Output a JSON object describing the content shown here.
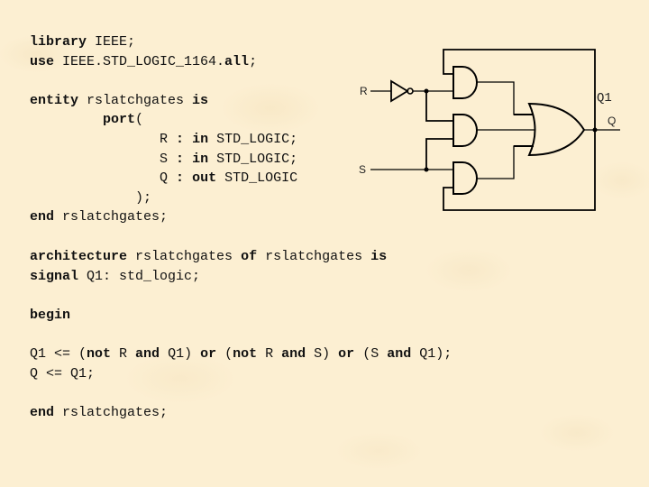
{
  "code_top": [
    [
      {
        "t": "library",
        "b": true
      },
      {
        "t": " IEEE;",
        "b": false
      }
    ],
    [
      {
        "t": "use",
        "b": true
      },
      {
        "t": " IEEE.STD_LOGIC_1164.",
        "b": false
      },
      {
        "t": "all",
        "b": true
      },
      {
        "t": ";",
        "b": false
      }
    ],
    [],
    [
      {
        "t": "entity",
        "b": true
      },
      {
        "t": " rslatchgates ",
        "b": false
      },
      {
        "t": "is",
        "b": true
      }
    ],
    [
      {
        "t": "         ",
        "b": false
      },
      {
        "t": "port",
        "b": true
      },
      {
        "t": "(",
        "b": false
      }
    ],
    [
      {
        "t": "                R ",
        "b": false
      },
      {
        "t": ":",
        "b": true
      },
      {
        "t": " ",
        "b": false
      },
      {
        "t": "in",
        "b": true
      },
      {
        "t": " STD_LOGIC;",
        "b": false
      }
    ],
    [
      {
        "t": "                S ",
        "b": false
      },
      {
        "t": ":",
        "b": true
      },
      {
        "t": " ",
        "b": false
      },
      {
        "t": "in",
        "b": true
      },
      {
        "t": " STD_LOGIC;",
        "b": false
      }
    ],
    [
      {
        "t": "                Q ",
        "b": false
      },
      {
        "t": ":",
        "b": true
      },
      {
        "t": " ",
        "b": false
      },
      {
        "t": "out",
        "b": true
      },
      {
        "t": " STD_LOGIC",
        "b": false
      }
    ],
    [
      {
        "t": "             );",
        "b": false
      }
    ],
    [
      {
        "t": "end",
        "b": true
      },
      {
        "t": " rslatchgates;",
        "b": false
      }
    ]
  ],
  "code_bottom": [
    [
      {
        "t": "architecture",
        "b": true
      },
      {
        "t": " rslatchgates ",
        "b": false
      },
      {
        "t": "of",
        "b": true
      },
      {
        "t": " rslatchgates ",
        "b": false
      },
      {
        "t": "is",
        "b": true
      }
    ],
    [
      {
        "t": "signal",
        "b": true
      },
      {
        "t": " Q1: std_logic;",
        "b": false
      }
    ],
    [],
    [
      {
        "t": "begin",
        "b": true
      }
    ],
    [],
    [
      {
        "t": "Q1 <= (",
        "b": false
      },
      {
        "t": "not",
        "b": true
      },
      {
        "t": " R ",
        "b": false
      },
      {
        "t": "and",
        "b": true
      },
      {
        "t": " Q1) ",
        "b": false
      },
      {
        "t": "or",
        "b": true
      },
      {
        "t": " (",
        "b": false
      },
      {
        "t": "not",
        "b": true
      },
      {
        "t": " R ",
        "b": false
      },
      {
        "t": "and",
        "b": true
      },
      {
        "t": " S) ",
        "b": false
      },
      {
        "t": "or",
        "b": true
      },
      {
        "t": " (S ",
        "b": false
      },
      {
        "t": "and",
        "b": true
      },
      {
        "t": " Q1);",
        "b": false
      }
    ],
    [
      {
        "t": "Q <= Q1;",
        "b": false
      }
    ],
    [],
    [
      {
        "t": "end",
        "b": true
      },
      {
        "t": " rslatchgates;",
        "b": false
      }
    ]
  ],
  "circuit": {
    "labels": {
      "input_r": "R",
      "input_s": "S",
      "signal_q1": "Q1",
      "output_q": "Q"
    },
    "gates": [
      {
        "type": "not",
        "name": "inverter-r",
        "inputs": [
          "R"
        ],
        "output": "notR"
      },
      {
        "type": "and",
        "name": "and-gate-top",
        "inputs": [
          "Q1",
          "notR"
        ],
        "output": "a1"
      },
      {
        "type": "and",
        "name": "and-gate-middle",
        "inputs": [
          "notR",
          "S"
        ],
        "output": "a2"
      },
      {
        "type": "and",
        "name": "and-gate-bottom",
        "inputs": [
          "S",
          "Q1"
        ],
        "output": "a3"
      },
      {
        "type": "or",
        "name": "or-gate",
        "inputs": [
          "a1",
          "a2",
          "a3"
        ],
        "output": "Q1"
      }
    ],
    "stroke_color": "#000000"
  },
  "background_color": "#fcefd2"
}
